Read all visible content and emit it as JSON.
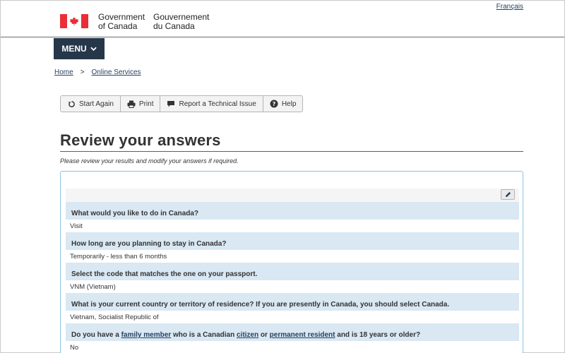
{
  "header": {
    "lang_link": "Français",
    "gov_en_line1": "Government",
    "gov_en_line2": "of Canada",
    "gov_fr_line1": "Gouvernement",
    "gov_fr_line2": "du Canada"
  },
  "menu": {
    "label": "MENU"
  },
  "breadcrumb": {
    "home": "Home",
    "separator": ">",
    "current": "Online Services"
  },
  "toolbar": {
    "start_again": "Start Again",
    "print": "Print",
    "report": "Report a Technical Issue",
    "help": "Help"
  },
  "page": {
    "title": "Review your answers",
    "intro": "Please review your results and modify your answers if required."
  },
  "answers": [
    {
      "question": "What would you like to do in Canada?",
      "answer": "Visit"
    },
    {
      "question": "How long are you planning to stay in Canada?",
      "answer": "Temporarily - less than 6 months"
    },
    {
      "question": "Select the code that matches the one on your passport.",
      "answer": "VNM (Vietnam)"
    },
    {
      "question": "What is your current country or territory of residence? If you are presently in Canada, you should select Canada.",
      "answer": "Vietnam, Socialist Republic of"
    },
    {
      "question_part1": "Do you have a ",
      "question_link1": "family member",
      "question_part2": " who is a Canadian ",
      "question_link2": "citizen",
      "question_part3": " or ",
      "question_link3": "permanent resident",
      "question_part4": " and is 18 years or older?",
      "answer": "No"
    }
  ],
  "colors": {
    "navy": "#26374a",
    "link": "#284162",
    "flag_red": "#eb2d37",
    "title_rule": "#af3c43",
    "question_bg": "#d9e8f3",
    "panel_border": "#8cc4e0"
  }
}
